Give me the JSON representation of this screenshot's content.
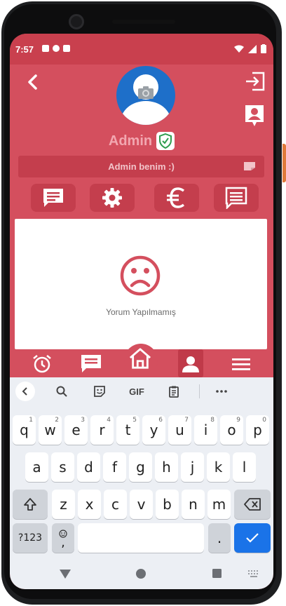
{
  "status_bar": {
    "time": "7:57"
  },
  "profile": {
    "username": "Admin",
    "bio": "Admin benim :)"
  },
  "comments": {
    "empty_text": "Yorum Yapılmamış"
  },
  "keyboard": {
    "toolbar": {
      "gif_label": "GIF"
    },
    "rows": [
      [
        {
          "label": "q",
          "hint": "1"
        },
        {
          "label": "w",
          "hint": "2"
        },
        {
          "label": "e",
          "hint": "3"
        },
        {
          "label": "r",
          "hint": "4"
        },
        {
          "label": "t",
          "hint": "5"
        },
        {
          "label": "y",
          "hint": "6"
        },
        {
          "label": "u",
          "hint": "7"
        },
        {
          "label": "i",
          "hint": "8"
        },
        {
          "label": "o",
          "hint": "9"
        },
        {
          "label": "p",
          "hint": "0"
        }
      ],
      [
        {
          "label": "a"
        },
        {
          "label": "s"
        },
        {
          "label": "d"
        },
        {
          "label": "f"
        },
        {
          "label": "g"
        },
        {
          "label": "h"
        },
        {
          "label": "j"
        },
        {
          "label": "k"
        },
        {
          "label": "l"
        }
      ],
      [
        {
          "label": "z"
        },
        {
          "label": "x"
        },
        {
          "label": "c"
        },
        {
          "label": "v"
        },
        {
          "label": "b"
        },
        {
          "label": "n"
        },
        {
          "label": "m"
        }
      ]
    ],
    "symbols_label": "?123",
    "comma_label": ",",
    "period_label": "."
  },
  "colors": {
    "primary": "#d44f5e",
    "status_bar": "#c9404e",
    "avatar_bg": "#1e6fc9",
    "enter_key": "#1a73e8",
    "verified": "#2e9d4e"
  },
  "icons": {
    "back": "chevron-left-icon",
    "logout": "exit-icon",
    "contact": "contact-card-icon",
    "camera": "camera-icon",
    "verified": "shield-check-icon",
    "note": "note-icon",
    "messages": "message-icon",
    "settings": "gear-icon",
    "currency": "euro-icon",
    "comments": "comment-icon",
    "empty": "sad-face-icon",
    "alarm": "alarm-icon",
    "home": "home-icon",
    "profile": "person-icon",
    "menu": "menu-icon"
  }
}
